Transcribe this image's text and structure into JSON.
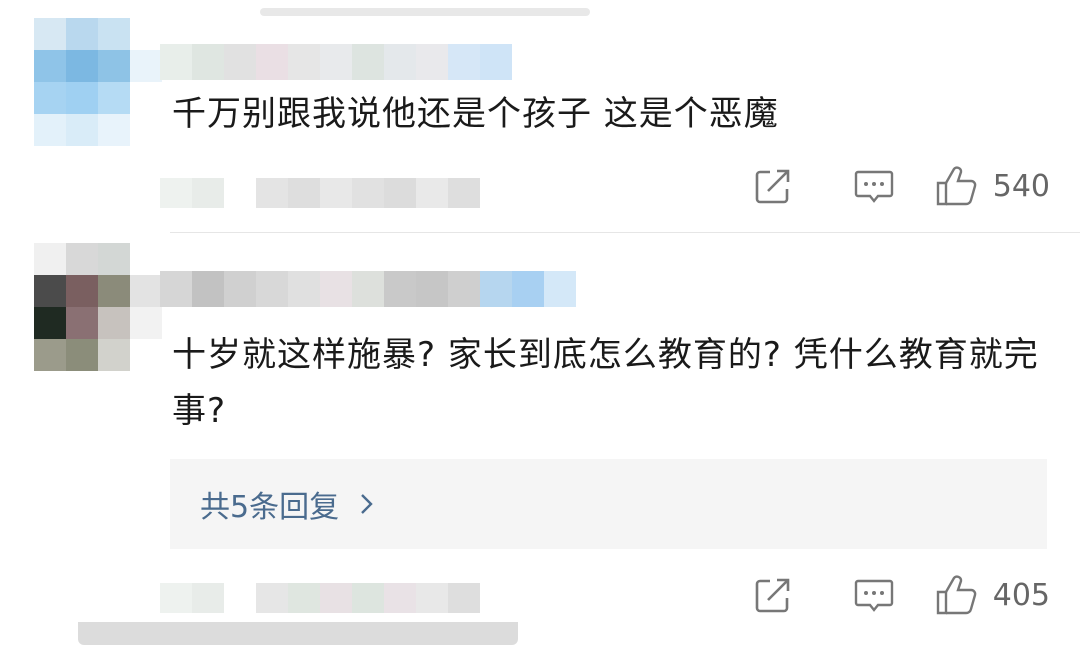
{
  "comments": [
    {
      "text": "千万别跟我说他还是个孩子 这是个恶魔",
      "likes": "540",
      "icons": {
        "share": "share-icon",
        "reply": "comment-icon",
        "like": "thumbs-up-icon"
      }
    },
    {
      "text": "十岁就这样施暴? 家长到底怎么教育的? 凭什么教育就完事?",
      "replies_label": "共5条回复",
      "likes": "405",
      "icons": {
        "share": "share-icon",
        "reply": "comment-icon",
        "like": "thumbs-up-icon",
        "chevron": "chevron-right-icon"
      }
    }
  ],
  "colors": {
    "text": "#1a1a1a",
    "muted": "#666666",
    "link": "#4a6b8e",
    "reply_bg": "#f5f5f5",
    "divider": "#e6e6e6"
  }
}
